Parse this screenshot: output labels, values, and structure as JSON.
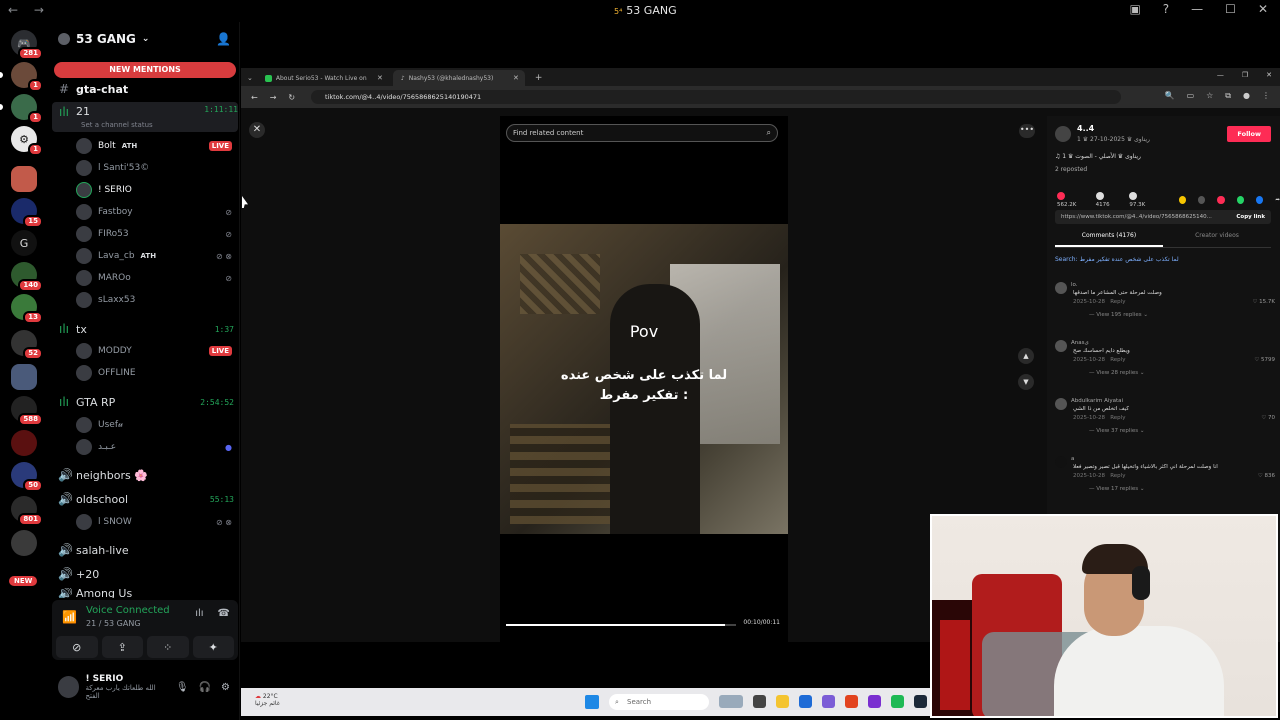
{
  "titlebar": {
    "title": "53 GANG",
    "badge": "5⁴"
  },
  "rail": {
    "servers": [
      {
        "badge": "281"
      },
      {
        "badge": "1"
      },
      {
        "badge": "1"
      },
      {
        "badge": "1"
      },
      {
        "badge": ""
      },
      {
        "badge": "15"
      },
      {
        "label": "G",
        "badge": ""
      },
      {
        "badge": "140"
      },
      {
        "badge": "13"
      },
      {
        "badge": "52"
      },
      {
        "badge": ""
      },
      {
        "badge": "588"
      },
      {
        "badge": ""
      },
      {
        "badge": "50"
      },
      {
        "badge": "801"
      },
      {
        "badge": ""
      }
    ],
    "new_label": "NEW"
  },
  "guild": {
    "name": "53 GANG",
    "new_mentions": "NEW MENTIONS"
  },
  "channels": {
    "gta_chat": "gta-chat",
    "ch21": {
      "name": "21",
      "time": "1:11:11",
      "status": "Set a channel status"
    },
    "ch21_users": [
      {
        "name": "Bolt",
        "tag": "ATH",
        "live": "LIVE"
      },
      {
        "name": "l Santi'53©"
      },
      {
        "name": "! SERIO"
      },
      {
        "name": "Fastboy"
      },
      {
        "name": "FIRo53"
      },
      {
        "name": "Lava_cb",
        "tag": "ATH"
      },
      {
        "name": "MAROo"
      },
      {
        "name": "sLaxx53"
      }
    ],
    "tx": {
      "name": "tx",
      "time": "1:37"
    },
    "tx_users": [
      {
        "name": "MODDY",
        "live": "LIVE"
      },
      {
        "name": "OFFLINE"
      }
    ],
    "gta_rp": {
      "name": "GTA RP",
      "time": "2:54:52"
    },
    "gta_rp_users": [
      {
        "name": "Usef𝓊"
      },
      {
        "name": "عـبـد"
      }
    ],
    "neighbors": "neighbors 🌸",
    "oldschool": {
      "name": "oldschool",
      "time": "55:13"
    },
    "oldschool_users": [
      {
        "name": "l SNOW"
      }
    ],
    "salah_live": "salah-live",
    "plus20": "+20",
    "among_us": "Among Us"
  },
  "voice": {
    "connected": "Voice Connected",
    "sub": "21 / 53 GANG"
  },
  "userbar": {
    "name": "! SERIO",
    "status": "الله طلعاتك يارب معركة الفتح"
  },
  "browser": {
    "tabs": [
      {
        "title": "About Serio53 - Watch Live on"
      },
      {
        "title": "Nashy53 (@khalednashy53)"
      }
    ],
    "url": "tiktok.com/@4..4/video/7565868625140190471"
  },
  "video": {
    "search_placeholder": "Find related content",
    "pov": "Pov",
    "caption_line1": "لما تكذب على شخص عنده",
    "caption_line2": "تفكير مفرط :",
    "time": "00:10/00:11",
    "progress": 0.95
  },
  "side": {
    "author": "4..4",
    "author_sub": "1 ♛ ريناوى ♛ 2025-10-27",
    "follow": "Follow",
    "desc": "♫ 1 ♛ ريناوى ♛ الأصلي - الصوت",
    "reposts": "2 reposted",
    "stats": [
      "562.2K",
      "4176",
      "97.3K"
    ],
    "link": "https://www.tiktok.com/@4..4/video/7565868625140...",
    "copy_link": "Copy link",
    "tab_comments": "Comments (4176)",
    "tab_creator": "Creator videos",
    "search_line": "Search: لما تكذب على شخص عنده تفكير مفرط",
    "comments": [
      {
        "user": "lo.",
        "text": "وصلت لمرحلة حتى المشاعر ما اصدقها",
        "date": "2025-10-28",
        "reply": "Reply",
        "likes": "15.7K",
        "more": "View 195 replies"
      },
      {
        "user": "Anasی",
        "text": "ويطلع دايم احساسك صح",
        "date": "2025-10-28",
        "reply": "Reply",
        "likes": "5799",
        "more": "View 28 replies"
      },
      {
        "user": "Abdulkarim Aiyatai",
        "text": "كيف اتخلص من ذا الشي",
        "date": "2025-10-28",
        "reply": "Reply",
        "likes": "70",
        "more": "View 37 replies"
      },
      {
        "user": "a",
        "text": "انا وصلت لمرحلة اني اكثر بالاشياء واتخيلها قبل تصير وتصير فعلا",
        "date": "2025-10-28",
        "reply": "Reply",
        "likes": "836",
        "more": "View 17 replies"
      }
    ]
  },
  "taskbar": {
    "weather": "22°C",
    "weather_sub": "غائم جزئيا",
    "search": "Search"
  }
}
